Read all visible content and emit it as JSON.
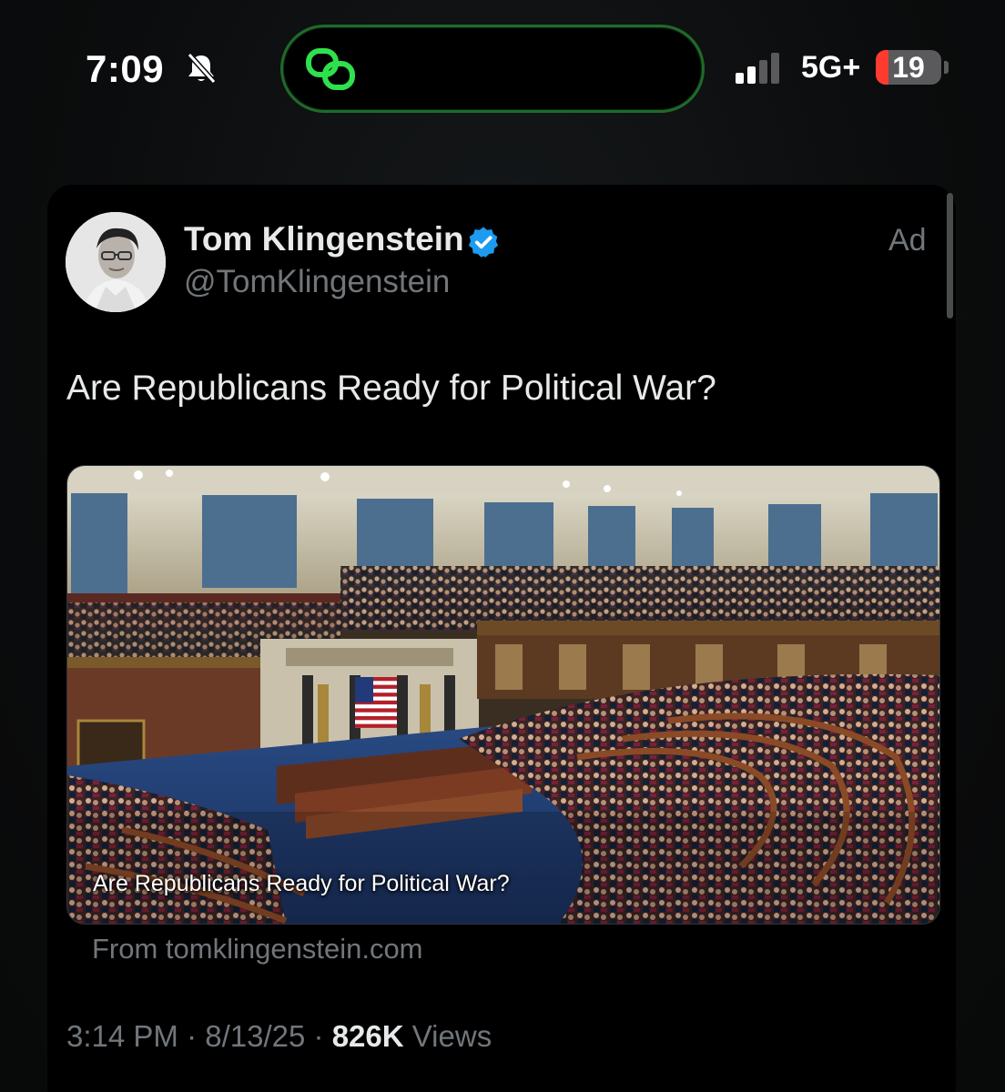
{
  "status_bar": {
    "time": "7:09",
    "network": "5G+",
    "battery": "19",
    "battery_fraction": 0.19,
    "icons": [
      "bell-slash-icon",
      "island-app-icon",
      "signal-icon"
    ]
  },
  "tweet": {
    "author_name": "Tom Klingenstein",
    "author_handle": "@TomKlingenstein",
    "ad_label": "Ad",
    "text": "Are Republicans Ready for Political War?",
    "card": {
      "title": "Are Republicans Ready for Political War?",
      "source": "From tomklingenstein.com"
    },
    "time": "3:14 PM",
    "date": "8/13/25",
    "views_count": "826K",
    "views_label": "Views"
  },
  "colors": {
    "accent_verified": "#1d9bf0",
    "island_border": "#1f6a2a",
    "island_icon": "#2fe04d",
    "battery_low": "#ff3b30"
  }
}
